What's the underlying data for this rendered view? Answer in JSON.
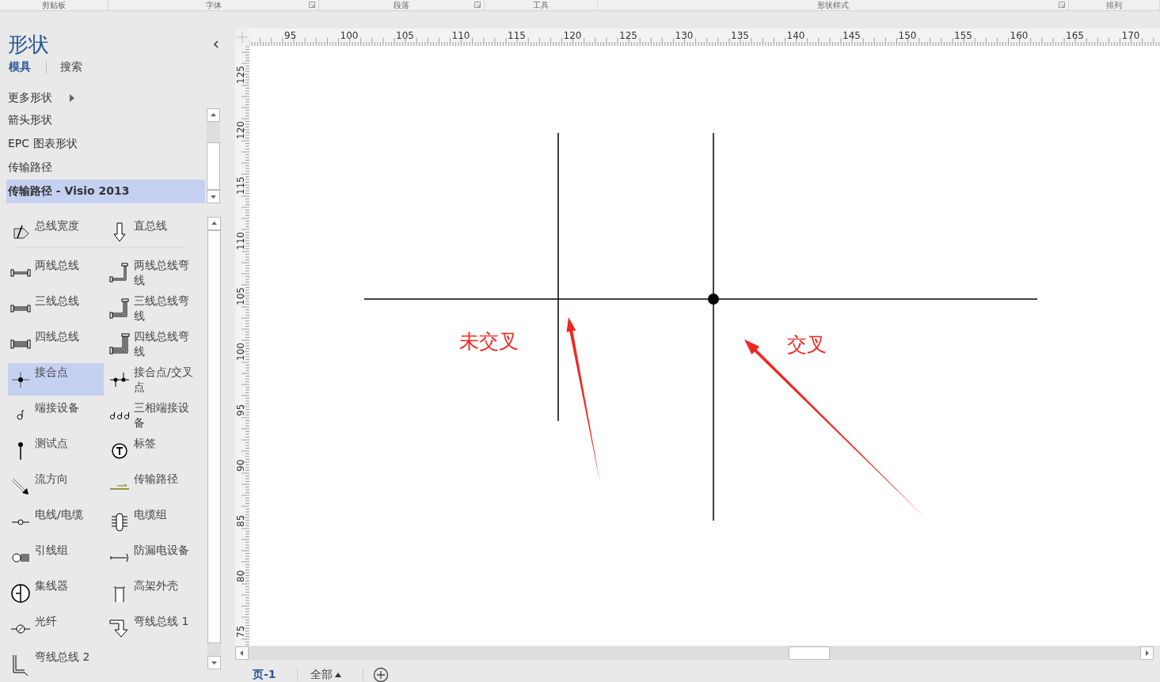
{
  "ribbon_groups": [
    {
      "label": "剪贴板",
      "launcher": false
    },
    {
      "label": "字体",
      "launcher": true
    },
    {
      "label": "段落",
      "launcher": true
    },
    {
      "label": "工具",
      "launcher": false
    },
    {
      "label": "形状样式",
      "launcher": true
    },
    {
      "label": "排列",
      "launcher": false
    }
  ],
  "shapes_pane": {
    "title": "形状",
    "tabs": [
      {
        "label": "模具",
        "selected": true
      },
      {
        "label": "搜索",
        "selected": false
      }
    ],
    "more_shapes": "更多形状",
    "stencils": [
      {
        "label": "箭头形状",
        "selected": false
      },
      {
        "label": "EPC 图表形状",
        "selected": false
      },
      {
        "label": "传输路径",
        "selected": false
      },
      {
        "label": "传输路径 - Visio 2013",
        "selected": true
      }
    ],
    "shapes": [
      {
        "label": "总线宽度",
        "selected": false
      },
      {
        "label": "直总线",
        "selected": false
      },
      {
        "label": "两线总线",
        "selected": false
      },
      {
        "label": "两线总线弯线",
        "selected": false
      },
      {
        "label": "三线总线",
        "selected": false
      },
      {
        "label": "三线总线弯线",
        "selected": false
      },
      {
        "label": "四线总线",
        "selected": false
      },
      {
        "label": "四线总线弯线",
        "selected": false
      },
      {
        "label": "接合点",
        "selected": true
      },
      {
        "label": "接合点/交叉点",
        "selected": false
      },
      {
        "label": "端接设备",
        "selected": false
      },
      {
        "label": "三相端接设备",
        "selected": false
      },
      {
        "label": "测试点",
        "selected": false
      },
      {
        "label": "标签",
        "selected": false
      },
      {
        "label": "流方向",
        "selected": false
      },
      {
        "label": "传输路径",
        "selected": false
      },
      {
        "label": "电线/电缆",
        "selected": false
      },
      {
        "label": "电缆组",
        "selected": false
      },
      {
        "label": "引线组",
        "selected": false
      },
      {
        "label": "防漏电设备",
        "selected": false
      },
      {
        "label": "集线器",
        "selected": false
      },
      {
        "label": "高架外壳",
        "selected": false
      },
      {
        "label": "光纤",
        "selected": false
      },
      {
        "label": "弯线总线 1",
        "selected": false
      },
      {
        "label": "弯线总线 2",
        "selected": false
      }
    ]
  },
  "rulers": {
    "horizontal": [
      "95",
      "100",
      "105",
      "110",
      "115",
      "120",
      "125",
      "130",
      "135",
      "140",
      "145",
      "150",
      "155",
      "160",
      "165",
      "170"
    ],
    "vertical": [
      "125",
      "120",
      "115",
      "110",
      "105",
      "100",
      "95",
      "90",
      "85",
      "80",
      "75"
    ]
  },
  "drawing": {
    "annotations": [
      {
        "text": "未交叉"
      },
      {
        "text": "交叉"
      }
    ]
  },
  "page_tabs": [
    {
      "label": "页-1",
      "selected": true
    },
    {
      "label": "全部",
      "selected": false
    }
  ]
}
